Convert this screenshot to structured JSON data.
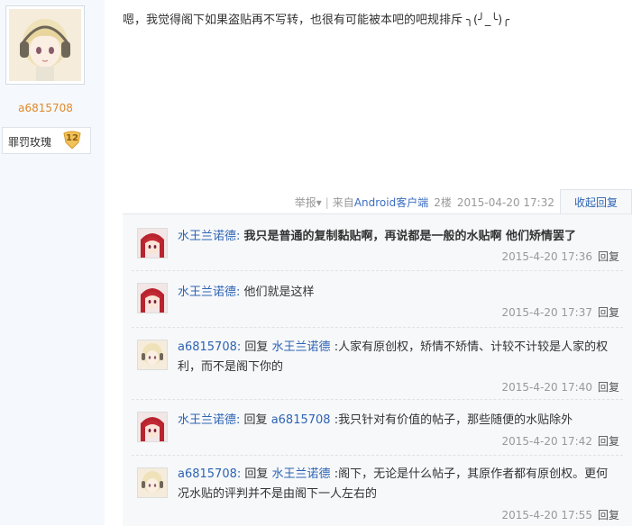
{
  "author": {
    "name": "a6815708",
    "rank_name": "罪罚玫瑰",
    "rank_level": "12"
  },
  "post": {
    "content": "嗯，我觉得阁下如果盗贴再不写转，也很有可能被本吧的吧规排斥 ╮(╯_╰)╭",
    "report": "举报",
    "source_prefix": "来自",
    "source_client": "Android客户端",
    "floor": "2楼",
    "time": "2015-04-20 17:32",
    "collapse_label": "收起回复"
  },
  "replies": [
    {
      "author": "水王兰诺德:",
      "reply_word": "",
      "target": "",
      "text": "我只是普通的复制黏贴啊，再说都是一般的水贴啊 他们矫情罢了",
      "time": "2015-4-20 17:36",
      "reply_label": "回复"
    },
    {
      "author": "水王兰诺德:",
      "reply_word": "",
      "target": "",
      "text": "他们就是这样",
      "time": "2015-4-20 17:37",
      "reply_label": "回复"
    },
    {
      "author": "a6815708:",
      "reply_word": "回复",
      "target": "水王兰诺德",
      "text": ":人家有原创权，矫情不矫情、计较不计较是人家的权利，而不是阁下你的",
      "time": "2015-4-20 17:40",
      "reply_label": "回复"
    },
    {
      "author": "水王兰诺德:",
      "reply_word": "回复",
      "target": "a6815708",
      "text": ":我只针对有价值的帖子，那些随便的水贴除外",
      "time": "2015-4-20 17:42",
      "reply_label": "回复"
    },
    {
      "author": "a6815708:",
      "reply_word": "回复",
      "target": "水王兰诺德",
      "text": ":阁下，无论是什么帖子，其原作者都有原创权。更何况水贴的评判并不是由阁下一人左右的",
      "time": "2015-4-20 17:55",
      "reply_label": "回复"
    }
  ]
}
